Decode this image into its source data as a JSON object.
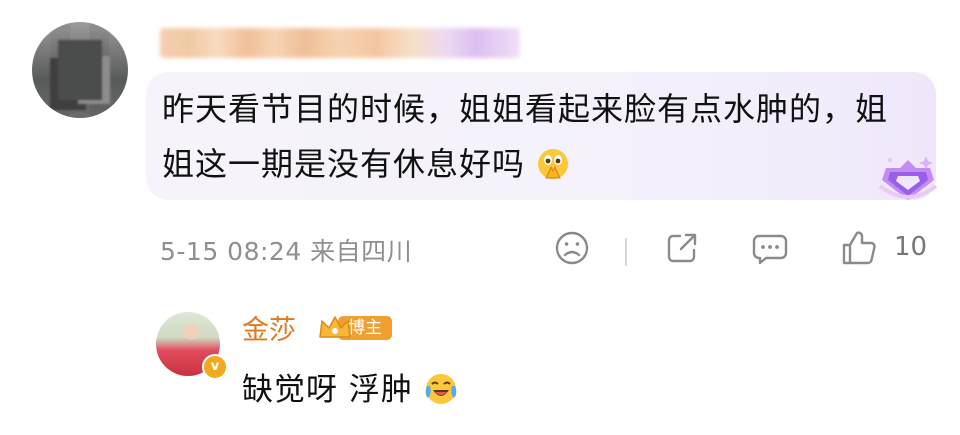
{
  "comment": {
    "text": "昨天看节目的时候，姐姐看起来脸有点水肿的，姐姐这一期是没有休息好吗",
    "emoji": "pray-emoji",
    "time_location": "5-15 08:24 来自四川",
    "like_count": "10"
  },
  "reply": {
    "author": "金莎",
    "author_color": "#e07a1f",
    "badge_label": "博主",
    "text": "缺觉呀 浮肿",
    "emoji": "laugh-cry-emoji"
  },
  "icons": [
    "sad-face-icon",
    "share-icon",
    "comment-icon",
    "thumbs-up-icon",
    "gem-badge-icon",
    "verified-icon",
    "crown-icon"
  ]
}
